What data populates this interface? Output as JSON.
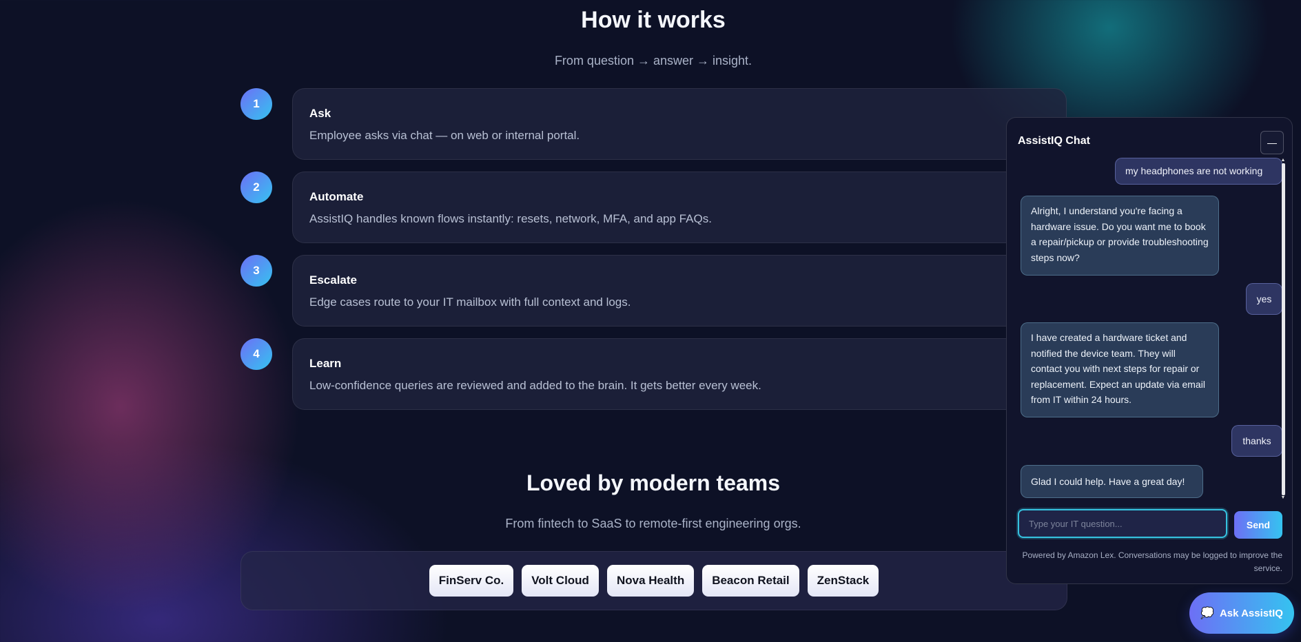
{
  "how_it_works": {
    "title": "How it works",
    "subtitle": "From question → answer → insight.",
    "steps": [
      {
        "number": "1",
        "title": "Ask",
        "description": "Employee asks via chat — on web or internal portal."
      },
      {
        "number": "2",
        "title": "Automate",
        "description": "AssistIQ handles known flows instantly: resets, network, MFA, and app FAQs."
      },
      {
        "number": "3",
        "title": "Escalate",
        "description": "Edge cases route to your IT mailbox with full context and logs."
      },
      {
        "number": "4",
        "title": "Learn",
        "description": "Low-confidence queries are reviewed and added to the brain. It gets better every week."
      }
    ]
  },
  "testimonials": {
    "title": "Loved by modern teams",
    "subtitle": "From fintech to SaaS to remote-first engineering orgs.",
    "logos": [
      "FinServ Co.",
      "Volt Cloud",
      "Nova Health",
      "Beacon Retail",
      "ZenStack"
    ]
  },
  "chat": {
    "title": "AssistIQ Chat",
    "minimize_label": "—",
    "messages": [
      {
        "role": "user",
        "text": "my headphones are not working"
      },
      {
        "role": "bot",
        "text": "Alright, I understand you're facing a hardware issue. Do you want me to book a repair/pickup or provide troubleshooting steps now?"
      },
      {
        "role": "user",
        "text": "yes"
      },
      {
        "role": "bot",
        "text": "I have created a hardware ticket and notified the device team. They will contact you with next steps for repair or replacement. Expect an update via email from IT within 24 hours."
      },
      {
        "role": "user",
        "text": "thanks"
      },
      {
        "role": "bot",
        "text": "Glad I could help. Have a great day!"
      }
    ],
    "input_placeholder": "Type your IT question...",
    "send_label": "Send",
    "footer": "Powered by Amazon Lex. Conversations may be logged to improve the service."
  },
  "launcher": {
    "label": "Ask AssistIQ",
    "icon": "chat-bubble-icon"
  },
  "colors": {
    "accent_start": "#6d6ff5",
    "accent_end": "#35c3f0",
    "background": "#0d1126"
  }
}
